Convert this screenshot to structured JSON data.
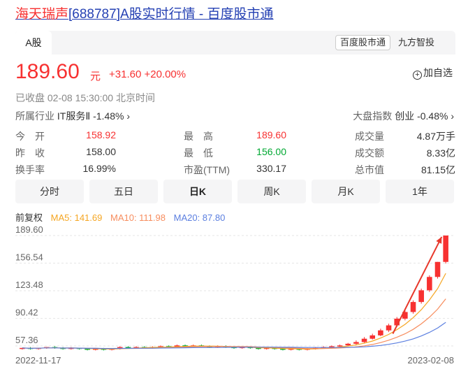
{
  "page_title": {
    "name": "海天瑞声",
    "code": "[688787]",
    "suffix": "A股实时行情 - 百度股市通"
  },
  "top_tab": "A股",
  "source": {
    "badge": "百度股市通",
    "other": "九方智投"
  },
  "quote": {
    "price": "189.60",
    "unit": "元",
    "change": "+31.60 +20.00%",
    "add_watch": "加自选",
    "status": "已收盘  02-08 15:30:00  北京时间",
    "industry_label": "所属行业",
    "industry_value": "IT服务Ⅱ -1.48% ›",
    "index_label": "大盘指数",
    "index_value": "创业 -0.48% ›"
  },
  "stats": {
    "open_label": "今　开",
    "open": "158.92",
    "high_label": "最　高",
    "high": "189.60",
    "volume_label": "成交量",
    "volume": "4.87万手",
    "prev_label": "昨　收",
    "prev": "158.00",
    "low_label": "最　低",
    "low": "156.00",
    "amount_label": "成交额",
    "amount": "8.33亿",
    "turnover_label": "换手率",
    "turnover": "16.99%",
    "pe_label": "市盈(TTM)",
    "pe": "330.17",
    "mcap_label": "总市值",
    "mcap": "81.15亿"
  },
  "periods": [
    "分时",
    "五日",
    "日K",
    "周K",
    "月K",
    "1年"
  ],
  "active_period": "日K",
  "legend": {
    "adjust": "前复权",
    "ma5": "MA5: 141.69",
    "ma10": "MA10: 111.98",
    "ma20": "MA20: 87.80"
  },
  "colors": {
    "up": "#f73131",
    "down": "#00a832",
    "ma5": "#f5a623",
    "ma10": "#f78d5e",
    "ma20": "#5b7fe0"
  },
  "chart_data": {
    "type": "candlestick",
    "y_ticks": [
      "189.60",
      "156.54",
      "123.48",
      "90.42",
      "57.36"
    ],
    "ylim": [
      57.36,
      189.6
    ],
    "x_labels": {
      "start": "2022-11-17",
      "end": "2023-02-08"
    },
    "candles": [
      [
        54,
        55,
        53,
        55
      ],
      [
        55,
        54,
        53,
        56
      ],
      [
        54,
        55,
        53,
        55
      ],
      [
        55,
        56,
        54,
        56
      ],
      [
        56,
        55,
        54,
        57
      ],
      [
        55,
        54,
        53,
        56
      ],
      [
        54,
        55,
        53,
        56
      ],
      [
        55,
        54,
        53,
        55
      ],
      [
        54,
        53,
        52,
        55
      ],
      [
        53,
        54,
        52,
        55
      ],
      [
        54,
        53,
        52,
        55
      ],
      [
        53,
        54,
        52,
        54
      ],
      [
        54,
        56,
        53,
        57
      ],
      [
        56,
        55,
        54,
        57
      ],
      [
        55,
        56,
        54,
        57
      ],
      [
        56,
        55,
        54,
        57
      ],
      [
        55,
        56,
        54,
        57
      ],
      [
        56,
        57,
        55,
        58
      ],
      [
        57,
        56,
        55,
        58
      ],
      [
        56,
        58,
        55,
        59
      ],
      [
        58,
        57,
        56,
        59
      ],
      [
        57,
        58,
        56,
        59
      ],
      [
        58,
        57,
        56,
        59
      ],
      [
        57,
        56,
        55,
        58
      ],
      [
        56,
        57,
        55,
        58
      ],
      [
        57,
        56,
        55,
        58
      ],
      [
        56,
        55,
        54,
        57
      ],
      [
        55,
        56,
        54,
        57
      ],
      [
        56,
        55,
        54,
        57
      ],
      [
        55,
        54,
        53,
        56
      ],
      [
        54,
        55,
        53,
        56
      ],
      [
        55,
        54,
        53,
        56
      ],
      [
        54,
        53,
        52,
        55
      ],
      [
        53,
        54,
        52,
        55
      ],
      [
        54,
        53,
        52,
        55
      ],
      [
        53,
        54,
        52,
        55
      ],
      [
        54,
        55,
        53,
        56
      ],
      [
        55,
        56,
        54,
        57
      ],
      [
        56,
        57,
        55,
        58
      ],
      [
        57,
        58,
        56,
        59
      ],
      [
        58,
        60,
        57,
        61
      ],
      [
        60,
        62,
        59,
        64
      ],
      [
        62,
        66,
        61,
        68
      ],
      [
        66,
        70,
        65,
        72
      ],
      [
        70,
        76,
        69,
        78
      ],
      [
        76,
        82,
        74,
        84
      ],
      [
        82,
        90,
        80,
        92
      ],
      [
        90,
        98,
        88,
        100
      ],
      [
        98,
        110,
        96,
        112
      ],
      [
        110,
        124,
        108,
        126
      ],
      [
        124,
        140,
        122,
        142
      ],
      [
        140,
        158,
        138,
        158
      ],
      [
        158,
        189.6,
        156,
        189.6
      ]
    ],
    "arrow": {
      "from": [
        46,
        72
      ],
      "to": [
        52,
        188
      ]
    }
  }
}
